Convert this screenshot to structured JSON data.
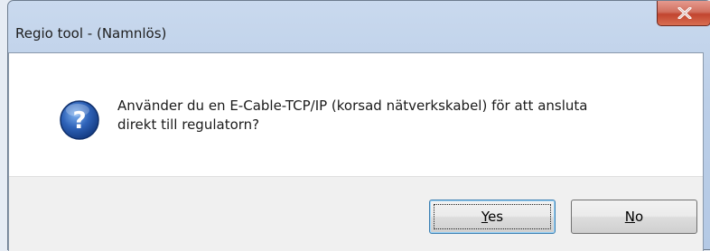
{
  "window": {
    "title": "Regio tool - (Namnlös)"
  },
  "dialog": {
    "icon": "question-icon",
    "message_line1": "Använder du en E-Cable-TCP/IP (korsad nätverkskabel) för att ansluta",
    "message_line2": "direkt till regulatorn?"
  },
  "buttons": {
    "yes": {
      "accel": "Y",
      "rest": "es"
    },
    "no": {
      "accel": "N",
      "rest": "o"
    }
  },
  "colors": {
    "close_button": "#c2452f",
    "icon_blue": "#2e62b8"
  }
}
